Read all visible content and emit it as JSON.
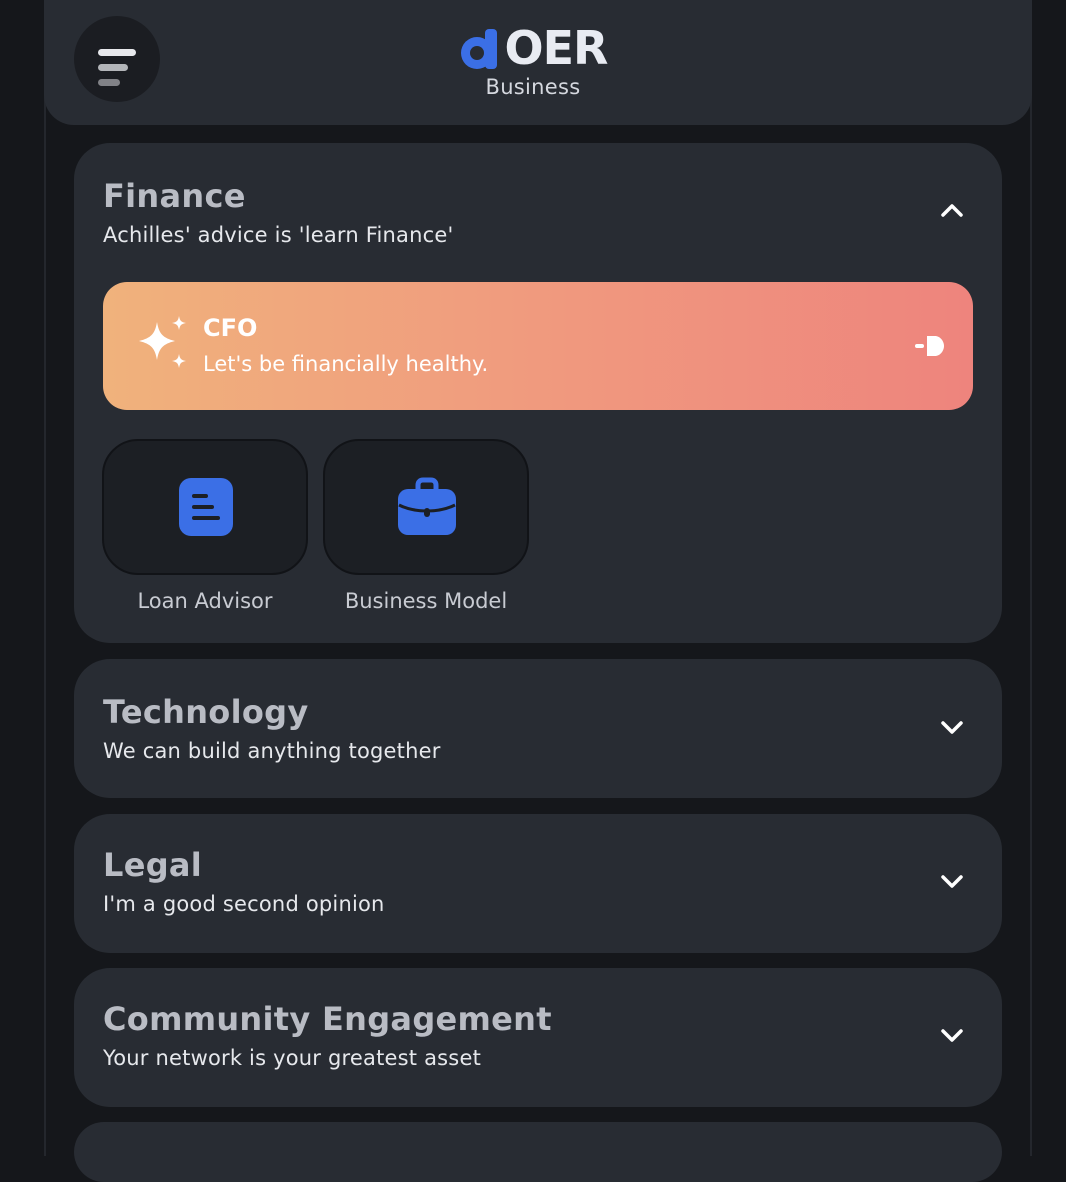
{
  "header": {
    "logo_text": "OER",
    "logo_sub": "Business",
    "menu_icon": "hamburger-icon"
  },
  "colors": {
    "brand_blue": "#3b6fe6",
    "card_bg": "#282c33",
    "cfo_gradient_start": "#f0b27c",
    "cfo_gradient_end": "#ee847d"
  },
  "sections": {
    "finance": {
      "title": "Finance",
      "subtitle": "Achilles' advice is 'learn Finance'",
      "expanded": true,
      "cfo": {
        "title": "CFO",
        "subtitle": "Let's be financially healthy.",
        "icon": "sparkles-icon",
        "action_icon": "arrow-right-icon"
      },
      "tools": [
        {
          "label": "Loan Advisor",
          "icon": "document-icon"
        },
        {
          "label": "Business Model",
          "icon": "briefcase-icon"
        }
      ]
    },
    "technology": {
      "title": "Technology",
      "subtitle": "We can build anything together",
      "expanded": false
    },
    "legal": {
      "title": "Legal",
      "subtitle": "I'm a good second opinion",
      "expanded": false
    },
    "community": {
      "title": "Community Engagement",
      "subtitle": "Your network is your greatest asset",
      "expanded": false
    }
  }
}
